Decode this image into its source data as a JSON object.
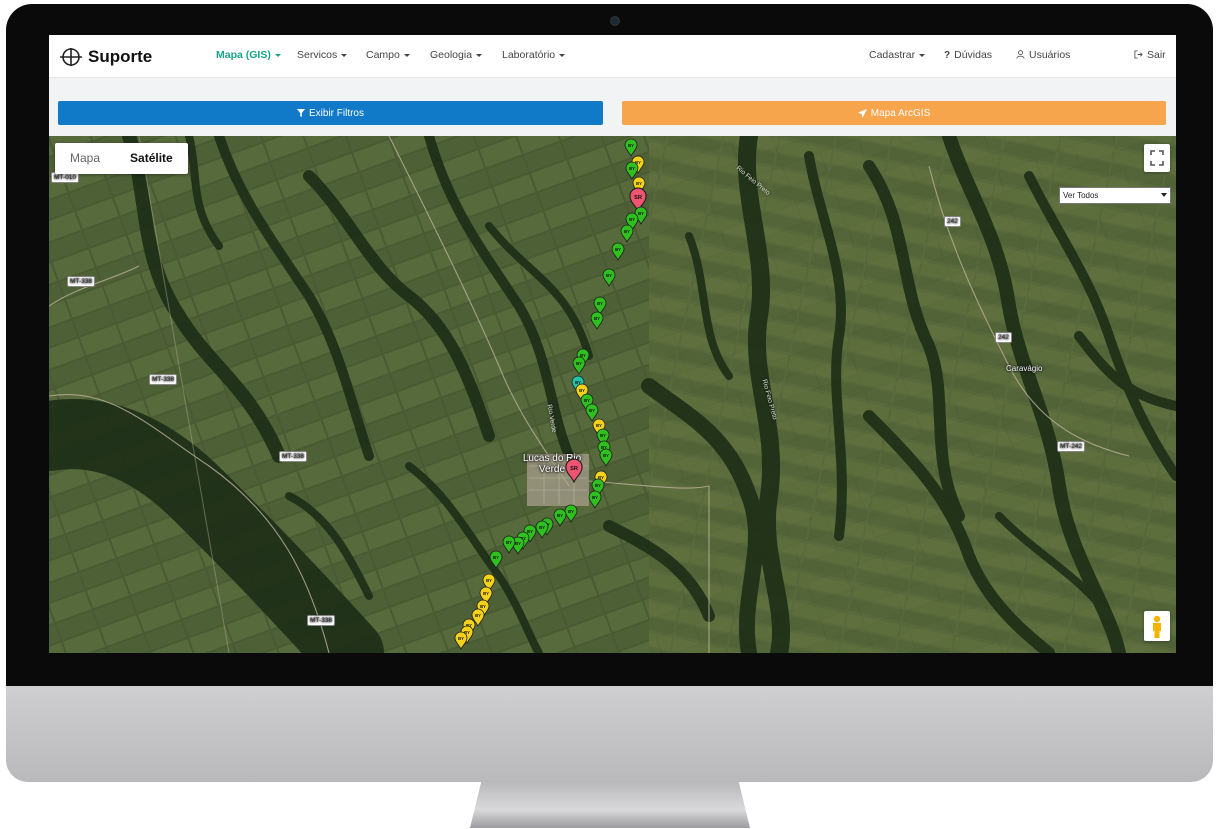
{
  "app": {
    "brand": "Suporte"
  },
  "nav": {
    "items": [
      {
        "label": "Mapa (GIS)",
        "active": true
      },
      {
        "label": "Servicos"
      },
      {
        "label": "Campo"
      },
      {
        "label": "Geologia"
      },
      {
        "label": "Laboratório"
      }
    ],
    "right": {
      "cadastrar": "Cadastrar",
      "duvidas": "Dúvidas",
      "usuarios": "Usuários",
      "sair": "Sair"
    }
  },
  "actions": {
    "filtros_label": "Exibir Filtros",
    "arcgis_label": "Mapa ArcGIS"
  },
  "map": {
    "type_control": {
      "mapa": "Mapa",
      "satelite": "Satélite",
      "selected": "Satélite"
    },
    "layer_select": "Ver Todos",
    "city": "Lucas do Rio Verde",
    "town": "Caravágio",
    "roads": [
      "MT-010",
      "MT-338",
      "MT-338",
      "MT-338",
      "MT-338",
      "242",
      "242",
      "MT-242"
    ],
    "rivers": [
      "Rio Verde",
      "Rio Feio Preto",
      "Rio Feio Preto"
    ],
    "marker_labels": {
      "green": "BY",
      "yellow": "BY",
      "red": "SR"
    },
    "colors": {
      "green": "#2fbf1f",
      "yellow": "#f4d21c",
      "red": "#ef5470",
      "teal": "#24c2a6"
    }
  }
}
